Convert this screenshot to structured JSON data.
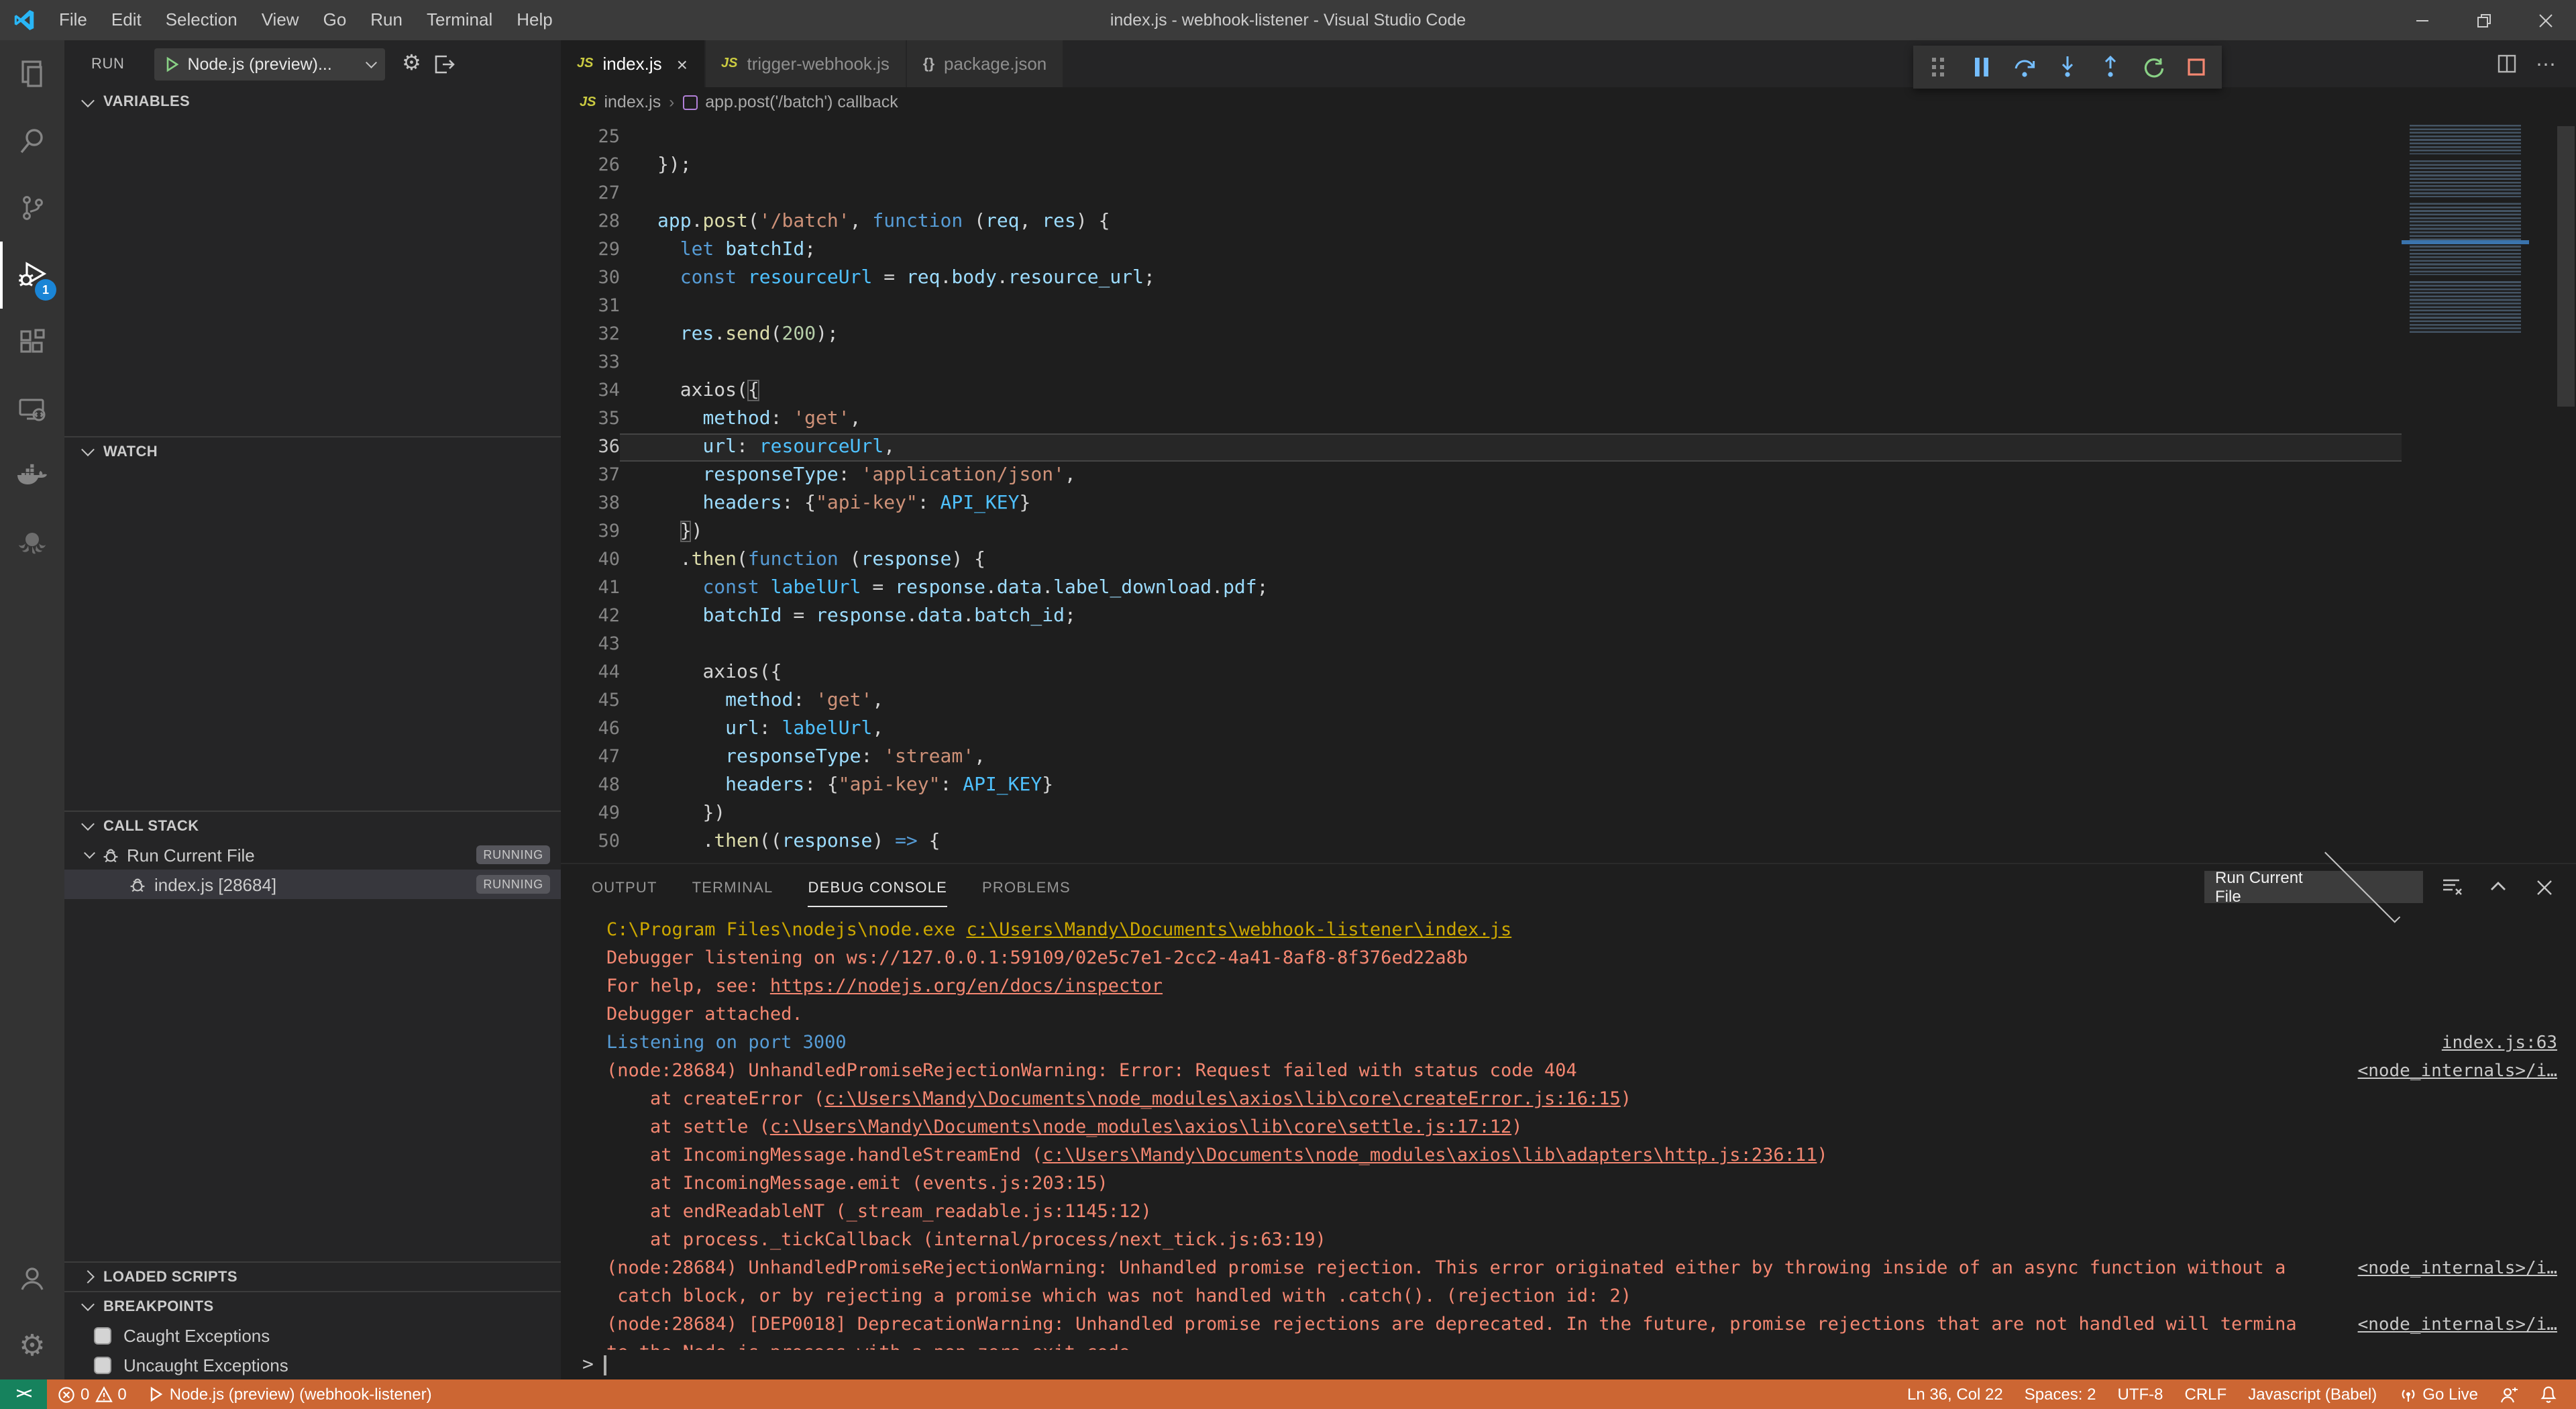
{
  "titlebar": {
    "menus": [
      "File",
      "Edit",
      "Selection",
      "View",
      "Go",
      "Run",
      "Terminal",
      "Help"
    ],
    "title": "index.js - webhook-listener - Visual Studio Code"
  },
  "activity_bar": {
    "debug_badge": "1"
  },
  "run_panel": {
    "header_label": "RUN",
    "config_label": "Node.js (preview)...",
    "sections": {
      "variables": "VARIABLES",
      "watch": "WATCH",
      "call_stack": "CALL STACK",
      "loaded_scripts": "LOADED SCRIPTS",
      "breakpoints": "BREAKPOINTS"
    },
    "call_stack_items": [
      {
        "label": "Run Current File",
        "badge": "RUNNING",
        "level": 1,
        "selected": false
      },
      {
        "label": "index.js [28684]",
        "badge": "RUNNING",
        "level": 2,
        "selected": true
      }
    ],
    "breakpoint_items": [
      {
        "label": "Caught Exceptions",
        "checked": false
      },
      {
        "label": "Uncaught Exceptions",
        "checked": false
      }
    ]
  },
  "tabs": [
    {
      "label": "index.js",
      "icon": "js",
      "active": true,
      "closable": true
    },
    {
      "label": "trigger-webhook.js",
      "icon": "js",
      "active": false,
      "closable": false
    },
    {
      "label": "package.json",
      "icon": "json",
      "active": false,
      "closable": false
    }
  ],
  "breadcrumb": {
    "file": "index.js",
    "separator": "›",
    "symbol": "app.post('/batch') callback"
  },
  "editor": {
    "current_line": 36,
    "lines": [
      {
        "n": 25,
        "tk": []
      },
      {
        "n": 26,
        "tk": [
          [
            "});",
            "p"
          ]
        ]
      },
      {
        "n": 27,
        "tk": []
      },
      {
        "n": 28,
        "tk": [
          [
            "app",
            "v"
          ],
          [
            ".",
            "p"
          ],
          [
            "post",
            "f"
          ],
          [
            "(",
            "p"
          ],
          [
            "'/batch'",
            "s"
          ],
          [
            ", ",
            "p"
          ],
          [
            "function",
            "k"
          ],
          [
            " (",
            "p"
          ],
          [
            "req",
            "v"
          ],
          [
            ", ",
            "p"
          ],
          [
            "res",
            "v"
          ],
          [
            ") {",
            "p"
          ]
        ]
      },
      {
        "n": 29,
        "tk": [
          [
            "  ",
            "p"
          ],
          [
            "let",
            "k"
          ],
          [
            " ",
            "p"
          ],
          [
            "batchId",
            "v"
          ],
          [
            ";",
            "p"
          ]
        ]
      },
      {
        "n": 30,
        "tk": [
          [
            "  ",
            "p"
          ],
          [
            "const",
            "k"
          ],
          [
            " ",
            "p"
          ],
          [
            "resourceUrl",
            "cv"
          ],
          [
            " = ",
            "p"
          ],
          [
            "req",
            "v"
          ],
          [
            ".",
            "p"
          ],
          [
            "body",
            "v"
          ],
          [
            ".",
            "p"
          ],
          [
            "resource_url",
            "v"
          ],
          [
            ";",
            "p"
          ]
        ]
      },
      {
        "n": 31,
        "tk": []
      },
      {
        "n": 32,
        "tk": [
          [
            "  ",
            "p"
          ],
          [
            "res",
            "v"
          ],
          [
            ".",
            "p"
          ],
          [
            "send",
            "f"
          ],
          [
            "(",
            "p"
          ],
          [
            "200",
            "n"
          ],
          [
            ");",
            "p"
          ]
        ]
      },
      {
        "n": 33,
        "tk": []
      },
      {
        "n": 34,
        "tk": [
          [
            "  ",
            "p"
          ],
          [
            "axios",
            "d"
          ],
          [
            "(",
            "p"
          ],
          [
            "{",
            "bm"
          ]
        ]
      },
      {
        "n": 35,
        "tk": [
          [
            "    ",
            "p"
          ],
          [
            "method",
            "v"
          ],
          [
            ": ",
            "p"
          ],
          [
            "'get'",
            "s"
          ],
          [
            ",",
            "p"
          ]
        ]
      },
      {
        "n": 36,
        "tk": [
          [
            "    ",
            "p"
          ],
          [
            "url",
            "v"
          ],
          [
            ": ",
            "p"
          ],
          [
            "resourceUrl",
            "cv"
          ],
          [
            ",",
            "p"
          ]
        ]
      },
      {
        "n": 37,
        "tk": [
          [
            "    ",
            "p"
          ],
          [
            "responseType",
            "v"
          ],
          [
            ": ",
            "p"
          ],
          [
            "'application/json'",
            "s"
          ],
          [
            ",",
            "p"
          ]
        ]
      },
      {
        "n": 38,
        "tk": [
          [
            "    ",
            "p"
          ],
          [
            "headers",
            "v"
          ],
          [
            ": {",
            "p"
          ],
          [
            "\"api-key\"",
            "s"
          ],
          [
            ": ",
            "p"
          ],
          [
            "API_KEY",
            "cv"
          ],
          [
            "}",
            "p"
          ]
        ]
      },
      {
        "n": 39,
        "tk": [
          [
            "  ",
            "p"
          ],
          [
            "}",
            "bm"
          ],
          [
            ")",
            "p"
          ]
        ]
      },
      {
        "n": 40,
        "tk": [
          [
            "  .",
            "p"
          ],
          [
            "then",
            "f"
          ],
          [
            "(",
            "p"
          ],
          [
            "function",
            "k"
          ],
          [
            " (",
            "p"
          ],
          [
            "response",
            "v"
          ],
          [
            ") {",
            "p"
          ]
        ]
      },
      {
        "n": 41,
        "tk": [
          [
            "    ",
            "p"
          ],
          [
            "const",
            "k"
          ],
          [
            " ",
            "p"
          ],
          [
            "labelUrl",
            "cv"
          ],
          [
            " = ",
            "p"
          ],
          [
            "response",
            "v"
          ],
          [
            ".",
            "p"
          ],
          [
            "data",
            "v"
          ],
          [
            ".",
            "p"
          ],
          [
            "label_download",
            "v"
          ],
          [
            ".",
            "p"
          ],
          [
            "pdf",
            "v"
          ],
          [
            ";",
            "p"
          ]
        ]
      },
      {
        "n": 42,
        "tk": [
          [
            "    ",
            "p"
          ],
          [
            "batchId",
            "v"
          ],
          [
            " = ",
            "p"
          ],
          [
            "response",
            "v"
          ],
          [
            ".",
            "p"
          ],
          [
            "data",
            "v"
          ],
          [
            ".",
            "p"
          ],
          [
            "batch_id",
            "v"
          ],
          [
            ";",
            "p"
          ]
        ]
      },
      {
        "n": 43,
        "tk": []
      },
      {
        "n": 44,
        "tk": [
          [
            "    ",
            "p"
          ],
          [
            "axios",
            "d"
          ],
          [
            "({",
            "p"
          ]
        ]
      },
      {
        "n": 45,
        "tk": [
          [
            "      ",
            "p"
          ],
          [
            "method",
            "v"
          ],
          [
            ": ",
            "p"
          ],
          [
            "'get'",
            "s"
          ],
          [
            ",",
            "p"
          ]
        ]
      },
      {
        "n": 46,
        "tk": [
          [
            "      ",
            "p"
          ],
          [
            "url",
            "v"
          ],
          [
            ": ",
            "p"
          ],
          [
            "labelUrl",
            "cv"
          ],
          [
            ",",
            "p"
          ]
        ]
      },
      {
        "n": 47,
        "tk": [
          [
            "      ",
            "p"
          ],
          [
            "responseType",
            "v"
          ],
          [
            ": ",
            "p"
          ],
          [
            "'stream'",
            "s"
          ],
          [
            ",",
            "p"
          ]
        ]
      },
      {
        "n": 48,
        "tk": [
          [
            "      ",
            "p"
          ],
          [
            "headers",
            "v"
          ],
          [
            ": {",
            "p"
          ],
          [
            "\"api-key\"",
            "s"
          ],
          [
            ": ",
            "p"
          ],
          [
            "API_KEY",
            "cv"
          ],
          [
            "}",
            "p"
          ]
        ]
      },
      {
        "n": 49,
        "tk": [
          [
            "    ",
            "p"
          ],
          [
            "})",
            "p"
          ]
        ]
      },
      {
        "n": 50,
        "tk": [
          [
            "    .",
            "p"
          ],
          [
            "then",
            "f"
          ],
          [
            "((",
            "p"
          ],
          [
            "response",
            "v"
          ],
          [
            ") ",
            "p"
          ],
          [
            "=>",
            "k"
          ],
          [
            " {",
            "p"
          ]
        ]
      }
    ]
  },
  "panel": {
    "tabs": [
      {
        "label": "OUTPUT",
        "active": false
      },
      {
        "label": "TERMINAL",
        "active": false
      },
      {
        "label": "DEBUG CONSOLE",
        "active": true
      },
      {
        "label": "PROBLEMS",
        "active": false
      }
    ],
    "selector": "Run Current File",
    "console": [
      {
        "seg": [
          [
            "C:\\Program Files\\nodejs\\node.exe ",
            "yellow",
            false
          ],
          [
            "c:\\Users\\Mandy\\Documents\\webhook-listener\\index.js",
            "yellow",
            true
          ]
        ],
        "right": ""
      },
      {
        "seg": [
          [
            "Debugger listening on ws://127.0.0.1:59109/02e5c7e1-2cc2-4a41-8af8-8f376ed22a8b",
            "red",
            false
          ]
        ],
        "right": ""
      },
      {
        "seg": [
          [
            "For help, see: ",
            "red",
            false
          ],
          [
            "https://nodejs.org/en/docs/inspector",
            "red",
            true
          ]
        ],
        "right": ""
      },
      {
        "seg": [
          [
            "Debugger attached.",
            "red",
            false
          ]
        ],
        "right": ""
      },
      {
        "seg": [
          [
            "Listening on port 3000",
            "blue",
            false
          ]
        ],
        "right": "index.js:63"
      },
      {
        "seg": [
          [
            "(node:28684) UnhandledPromiseRejectionWarning: Error: Request failed with status code 404",
            "red",
            false
          ]
        ],
        "right": "<node_internals>/i…"
      },
      {
        "seg": [
          [
            "    at createError (",
            "red",
            false
          ],
          [
            "c:\\Users\\Mandy\\Documents\\node_modules\\axios\\lib\\core\\createError.js:16:15",
            "red",
            true
          ],
          [
            ")",
            "red",
            false
          ]
        ],
        "right": ""
      },
      {
        "seg": [
          [
            "    at settle (",
            "red",
            false
          ],
          [
            "c:\\Users\\Mandy\\Documents\\node_modules\\axios\\lib\\core\\settle.js:17:12",
            "red",
            true
          ],
          [
            ")",
            "red",
            false
          ]
        ],
        "right": ""
      },
      {
        "seg": [
          [
            "    at IncomingMessage.handleStreamEnd (",
            "red",
            false
          ],
          [
            "c:\\Users\\Mandy\\Documents\\node_modules\\axios\\lib\\adapters\\http.js:236:11",
            "red",
            true
          ],
          [
            ")",
            "red",
            false
          ]
        ],
        "right": ""
      },
      {
        "seg": [
          [
            "    at IncomingMessage.emit (events.js:203:15)",
            "red",
            false
          ]
        ],
        "right": ""
      },
      {
        "seg": [
          [
            "    at endReadableNT (_stream_readable.js:1145:12)",
            "red",
            false
          ]
        ],
        "right": ""
      },
      {
        "seg": [
          [
            "    at process._tickCallback (internal/process/next_tick.js:63:19)",
            "red",
            false
          ]
        ],
        "right": ""
      },
      {
        "seg": [
          [
            "(node:28684) UnhandledPromiseRejectionWarning: Unhandled promise rejection. This error originated either by throwing inside of an async function without a",
            "red",
            false
          ]
        ],
        "right": "<node_internals>/i…"
      },
      {
        "seg": [
          [
            " catch block, or by rejecting a promise which was not handled with .catch(). (rejection id: 2)",
            "red",
            false
          ]
        ],
        "right": ""
      },
      {
        "seg": [
          [
            "(node:28684) [DEP0018] DeprecationWarning: Unhandled promise rejections are deprecated. In the future, promise rejections that are not handled will termina",
            "red",
            false
          ]
        ],
        "right": "<node_internals>/i…"
      },
      {
        "seg": [
          [
            "te the Node.js process with a non-zero exit code.",
            "red",
            false
          ]
        ],
        "right": ""
      }
    ]
  },
  "status_bar": {
    "errors": "0",
    "warnings": "0",
    "debug_label": "Node.js (preview) (webhook-listener)",
    "line_col": "Ln 36, Col 22",
    "spaces": "Spaces: 2",
    "encoding": "UTF-8",
    "eol": "CRLF",
    "language": "Javascript (Babel)",
    "go_live": "Go Live",
    "colors": {
      "bar": "#cc6633",
      "remote": "#16825d"
    }
  }
}
